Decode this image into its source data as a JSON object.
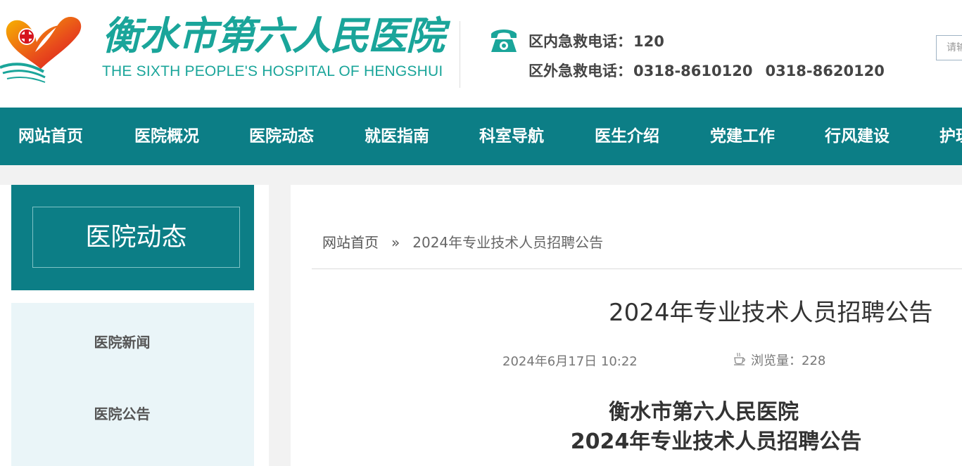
{
  "header": {
    "logo_cn": "衡水市第六人民医院",
    "logo_en": "THE SIXTH PEOPLE'S HOSPITAL OF HENGSHUI",
    "emergency_inner_label": "区内急救电话：",
    "emergency_inner_number": "120",
    "emergency_outer_label": "区外急救电话：",
    "emergency_outer_number1": "0318-8610120",
    "emergency_outer_number2": "0318-8620120",
    "search_placeholder": "请输入"
  },
  "nav": {
    "items": [
      "网站首页",
      "医院概况",
      "医院动态",
      "就医指南",
      "科室导航",
      "医生介绍",
      "党建工作",
      "行风建设",
      "护理"
    ]
  },
  "sidebar": {
    "title": "医院动态",
    "items": [
      "医院新闻",
      "医院公告"
    ]
  },
  "breadcrumb": {
    "home": "网站首页",
    "separator": "»",
    "current": "2024年专业技术人员招聘公告"
  },
  "article": {
    "title": "2024年专业技术人员招聘公告",
    "date": "2024年6月17日 10:22",
    "views_label": "浏览量：",
    "views": "228",
    "headline_line1": "衡水市第六人民医院",
    "headline_line2": "2024年专业技术人员招聘公告"
  },
  "colors": {
    "brand_teal": "#0c7e86",
    "logo_teal": "#1aa59a",
    "sidebar_list_bg": "#eaf5f8"
  }
}
